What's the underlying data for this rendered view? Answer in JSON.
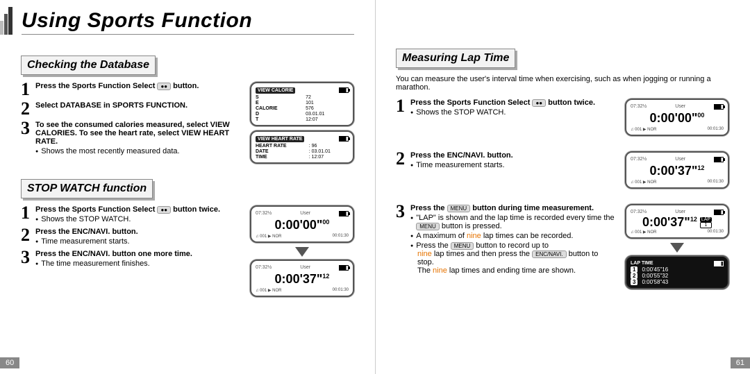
{
  "heading": "Using Sports Function",
  "left": {
    "checking": {
      "title": "Checking the Database",
      "s1": "Press the Sports Function Select",
      "s1b": "button.",
      "s2": "Select DATABASE in SPORTS FUNCTION.",
      "s3": "To see the consumed calories measured, select VIEW CALORIES. To see the heart rate, select VIEW HEART RATE.",
      "s3bullet": "Shows the most recently measured data.",
      "screens": {
        "cal_label": "VIEW CALORIE",
        "cal": {
          "S": "72",
          "E": "101",
          "CALORIE": "576",
          "D": "03.01.01",
          "T": "12:07"
        },
        "hr_label": "VIEW HEART RATE",
        "hr": {
          "HEART RATE": "96",
          "DATE": "03.01.01",
          "TIME": "12:07"
        }
      }
    },
    "stopwatch": {
      "title": "STOP WATCH function",
      "s1": "Press the Sports Function Select",
      "s1b": "button twice.",
      "s1bullet": "Shows the STOP WATCH.",
      "s2": "Press the ENC/NAVI. button.",
      "s2bullet": "Time measurement starts.",
      "s3": "Press the ENC/NAVI. button one more time.",
      "s3bullet": "The time measurement finishes.",
      "screens": {
        "top": {
          "clock": "07:32½",
          "user": "User",
          "time": "0:00'00\"",
          "sub": "00",
          "nor": "001",
          "elapsed": "00:01:30"
        },
        "bot": {
          "clock": "07:32½",
          "user": "User",
          "time": "0:00'37\"",
          "sub": "12",
          "nor": "001",
          "elapsed": "00:01:30"
        }
      }
    },
    "page_num": "60"
  },
  "right": {
    "lap": {
      "title": "Measuring Lap Time",
      "intro": "You can measure the user's interval time when exercising, such as when jogging or running a marathon.",
      "s1": "Press the Sports Function Select",
      "s1b": "button twice.",
      "s1bullet": "Shows the STOP WATCH.",
      "s2": "Press the ENC/NAVI. button.",
      "s2bullet": "Time measurement starts.",
      "s3a": "Press the",
      "s3b": "button during time measurement.",
      "s3bul_a": "\"LAP\" is shown and the lap time is recorded every time the",
      "s3bul_a2": "button is pressed.",
      "s3bul_b_pre": "A maximum of",
      "s3bul_b_mid": "nine",
      "s3bul_b_post": "lap times can be recorded.",
      "s3bul_c_pre": "Press the",
      "s3bul_c_mid": "button to record up to",
      "s3bul_d_pre": "nine",
      "s3bul_d_mid": "lap times and then press the",
      "s3bul_d_post": "button to stop.",
      "s3bul_e_pre": "The",
      "s3bul_e_mid": "nine",
      "s3bul_e_post": "lap times and ending time are shown.",
      "chip_menu": "MENU",
      "chip_encnavi": "ENC/NAVI.",
      "screens": {
        "a": {
          "clock": "07:32½",
          "user": "User",
          "time": "0:00'00\"",
          "sub": "00",
          "nor": "001",
          "elapsed": "00:01:30"
        },
        "b": {
          "clock": "07:32½",
          "user": "User",
          "time": "0:00'37\"",
          "sub": "12",
          "nor": "001",
          "elapsed": "00:01:30"
        },
        "c": {
          "clock": "07:32½",
          "user": "User",
          "time": "0:00'37\"",
          "sub": "12",
          "lap": "LAP",
          "lapn": "1",
          "nor": "001",
          "elapsed": "00:01:30"
        },
        "d": {
          "title": "LAP TIME",
          "rows": [
            {
              "n": "1",
              "t": "0:00'45\"16"
            },
            {
              "n": "2",
              "t": "0:00'55\"32"
            },
            {
              "n": "3",
              "t": "0:00'58\"43"
            }
          ]
        }
      }
    },
    "page_num": "61"
  },
  "icons": {
    "select": "●●"
  }
}
